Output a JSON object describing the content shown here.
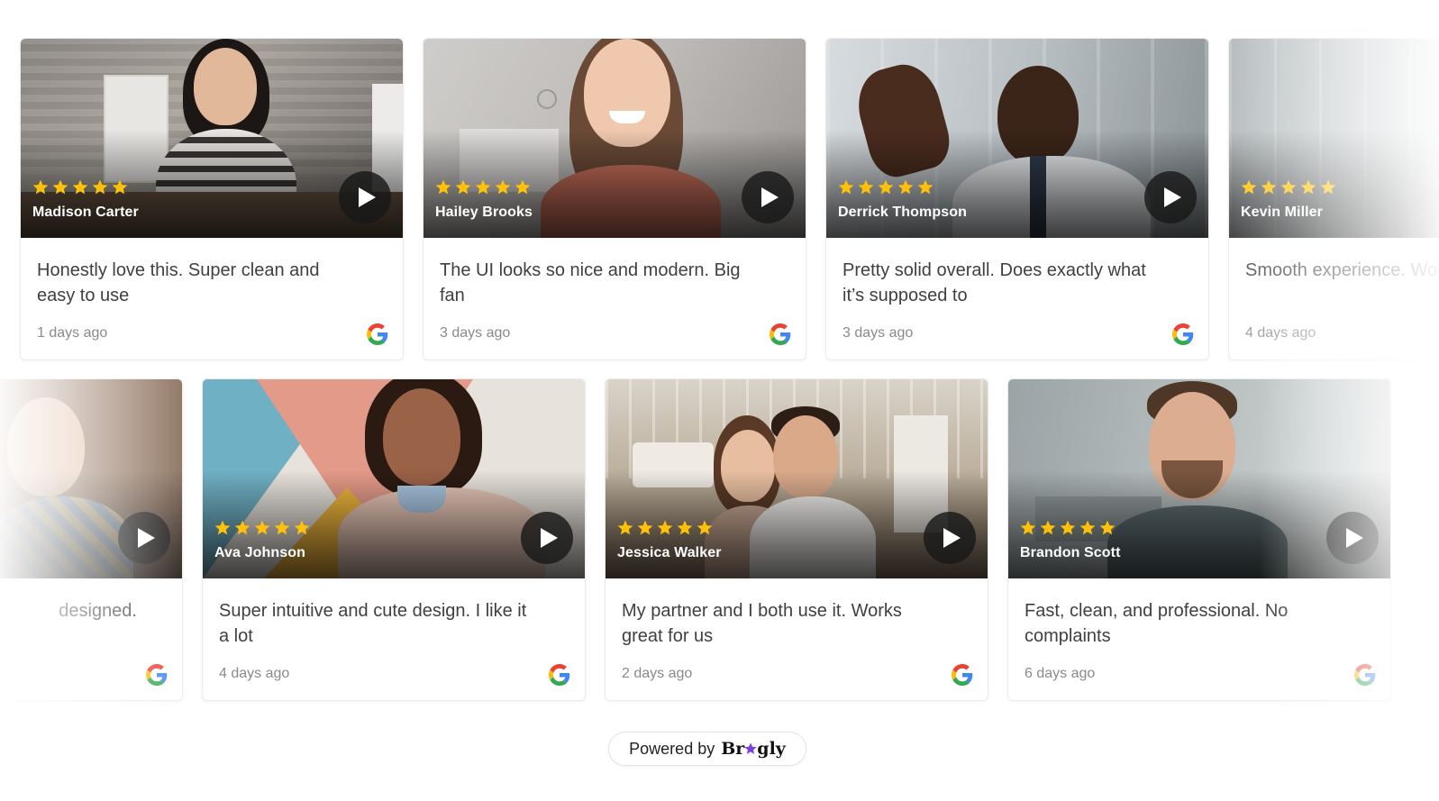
{
  "row1": [
    {
      "name": "Madison Carter",
      "text": "Honestly love this. Super clean and easy to use",
      "date": "1 days ago"
    },
    {
      "name": "Hailey Brooks",
      "text": "The UI looks so nice and modern. Big fan",
      "date": "3 days ago"
    },
    {
      "name": "Derrick Thompson",
      "text": "Pretty solid overall. Does exactly what it’s supposed to",
      "date": "3 days ago"
    },
    {
      "name": "Kevin Miller",
      "text": "Smooth experience. Would recommend",
      "date": "4 days ago"
    }
  ],
  "row2": [
    {
      "name": "",
      "text": "designed.",
      "date": ""
    },
    {
      "name": "Ava Johnson",
      "text": "Super intuitive and cute design. I like it a lot",
      "date": "4 days ago"
    },
    {
      "name": "Jessica Walker",
      "text": "My partner and I both use it. Works great for us",
      "date": "2 days ago"
    },
    {
      "name": "Brandon Scott",
      "text": "Fast, clean, and professional. No complaints",
      "date": "6 days ago"
    }
  ],
  "footer": {
    "powered_label": "Powered by",
    "brand_prefix": "Br",
    "brand_suffix": "gly"
  },
  "icons": {
    "star": "star-icon",
    "play": "play-icon",
    "google": "google-icon",
    "brand_star": "star-icon"
  },
  "colors": {
    "star": "#FFC107",
    "brand_star": "#7B3FE4"
  }
}
